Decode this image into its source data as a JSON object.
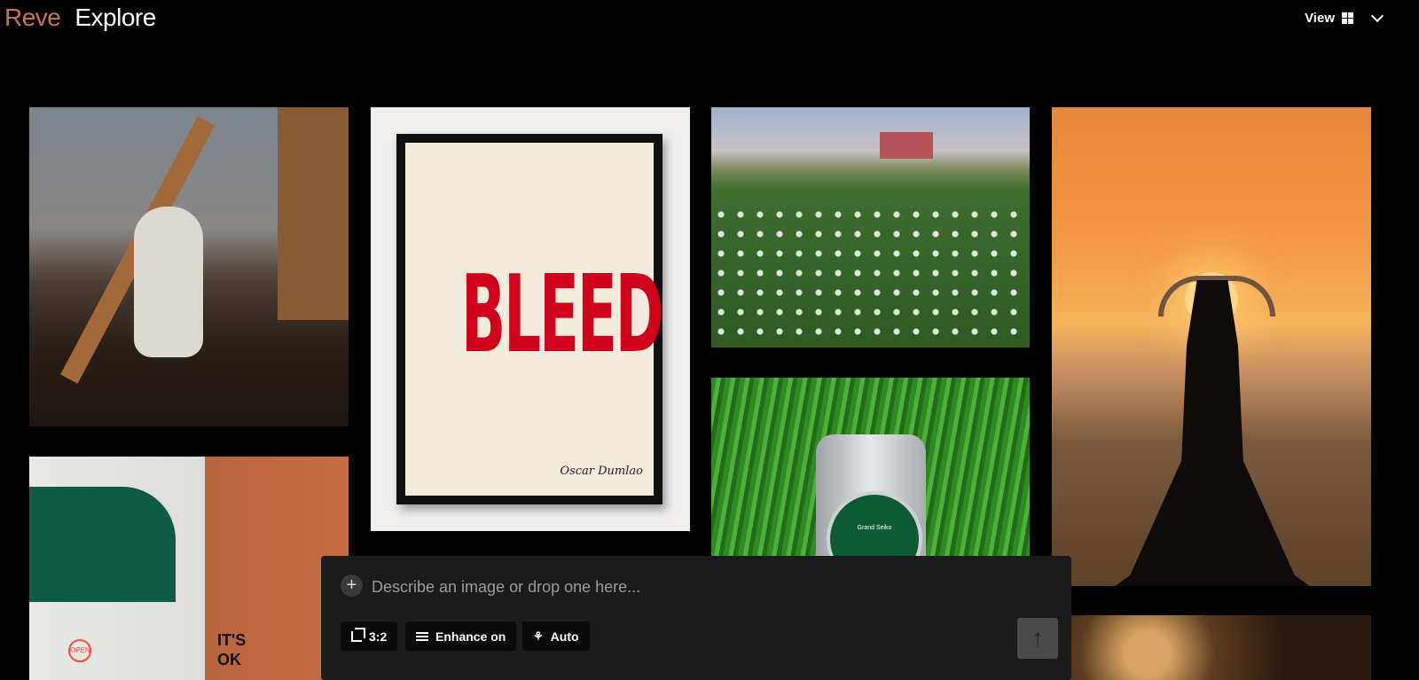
{
  "header": {
    "brand": "Reve",
    "section": "Explore",
    "view_label": "View",
    "view_icon": "grid-icon",
    "dropdown_icon": "chevron-down-icon"
  },
  "gallery": {
    "poster_text": "BLEED",
    "poster_signature": "Oscar Dumlao",
    "watch_brand": "Grand Seiko",
    "neon_sign": "OPEN",
    "wall_text_line1": "IT'S",
    "wall_text_line2": "OK"
  },
  "composer": {
    "placeholder": "Describe an image or drop one here...",
    "aspect_ratio": "3:2",
    "enhance_label": "Enhance on",
    "mode_label": "Auto",
    "send_icon": "arrow-up-icon"
  },
  "colors": {
    "brand": "#c8744e",
    "background": "#000000",
    "composer_bg": "#1b1b1b",
    "poster_red": "#d0021b"
  }
}
